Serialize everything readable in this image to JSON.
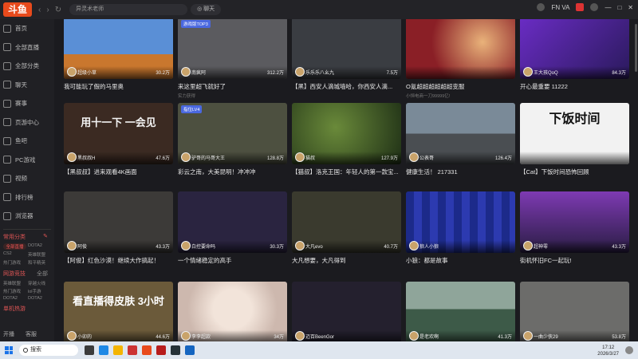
{
  "app": {
    "logo": "斗鱼"
  },
  "topbar": {
    "search_placeholder": "异灵术老师",
    "chat_label": "聊天",
    "right_status": "FN VA"
  },
  "sidebar": {
    "items": [
      {
        "label": "首页",
        "icon": "home-icon"
      },
      {
        "label": "全部直播",
        "icon": "live-icon"
      },
      {
        "label": "全部分类",
        "icon": "category-icon"
      },
      {
        "label": "聊天",
        "icon": "chat-icon"
      },
      {
        "label": "赛事",
        "icon": "trophy-icon"
      },
      {
        "label": "页游中心",
        "icon": "game-icon"
      },
      {
        "label": "鱼吧",
        "icon": "fish-icon"
      },
      {
        "label": "PC游戏",
        "icon": "pc-icon"
      },
      {
        "label": "视频",
        "icon": "video-icon"
      },
      {
        "label": "排行榜",
        "icon": "rank-icon"
      },
      {
        "label": "浏览器",
        "icon": "browser-icon"
      }
    ],
    "common_title": "常用分类",
    "common_tags": [
      "全部直播",
      "DOTA2",
      "CS2",
      "英雄联盟",
      "热门游戏",
      "和平精英"
    ],
    "web_title": "网游竞技",
    "web_more": "全部",
    "web_tags": [
      "英雄联盟",
      "穿越火线",
      "热门游戏",
      "lol手游",
      "DOTA2",
      "DOTA2"
    ],
    "single_title": "单机热游",
    "bottom": [
      "开播",
      "客服"
    ]
  },
  "cards": [
    {
      "title": "我可能玩了假的马里奥",
      "streamer": "超级小草",
      "hot": "30.2万",
      "tag": "",
      "sub": "",
      "color": "#5a8fd6",
      "art": "mario"
    },
    {
      "title": "来这里超飞就好了",
      "streamer": "南疯阿",
      "hot": "312.2万",
      "tag": "游戏版TOP3",
      "sub": "实力获得",
      "color": "#5b5b5f",
      "art": "wheel"
    },
    {
      "title": "【黑】西安人滴城墙哈，你西安人滴...",
      "streamer": "乐乐乐八幺九",
      "hot": "7.5万",
      "tag": "",
      "sub": "",
      "color": "#3a3d42",
      "art": "dark"
    },
    {
      "title": "O氪超超超超超超变服",
      "streamer": "",
      "hot": "",
      "tag": "",
      "sub": "小恒电商一刀99999亿!",
      "color": "#8a1f26",
      "art": "promo"
    },
    {
      "title": "开心最重要 11222",
      "streamer": "王大孩QoQ",
      "hot": "84.3万",
      "tag": "",
      "sub": "",
      "color": "#6a2cc4",
      "art": "girl"
    },
    {
      "title": "【黑叔叔】进来观看4K画面",
      "streamer": "黑叔叔H",
      "hot": "47.6万",
      "tag": "",
      "sub": "",
      "color": "#3b2a22",
      "art": "calligraphy",
      "big": "用十一下 一会见"
    },
    {
      "title": "彩云之南，大美昆明！冲冲冲",
      "streamer": "驴哥的马哥大王",
      "hot": "128.8万",
      "tag": "指位LV4",
      "sub": "",
      "color": "#4d5040",
      "art": "outdoor"
    },
    {
      "title": "【猫叔】洛克王国：年轻人的第一款宝...",
      "streamer": "猫叔",
      "hot": "127.9万",
      "tag": "",
      "sub": "",
      "color": "#2f4a22",
      "art": "green"
    },
    {
      "title": "健康生活！ 217331",
      "streamer": "公表哥",
      "hot": "126.4万",
      "tag": "",
      "sub": "",
      "color": "#5b6a78",
      "art": "street"
    },
    {
      "title": "【Cat】下饭时间恐怖回顾",
      "streamer": "",
      "hot": "",
      "tag": "",
      "sub": "",
      "color": "#f2f2f2",
      "art": "cat",
      "big": "下饭时间"
    },
    {
      "title": "【阿俊】红色沙漠！继续大作搞起！",
      "streamer": "阿俊",
      "hot": "43.3万",
      "tag": "",
      "sub": "",
      "color": "#3c3a38",
      "art": "multi"
    },
    {
      "title": "一个情绪稳定的高手",
      "streamer": "白控要命吗",
      "hot": "30.3万",
      "tag": "",
      "sub": "",
      "color": "#2a2440",
      "art": "pixel"
    },
    {
      "title": "大凡想要，大凡得到",
      "streamer": "大凡evo",
      "hot": "40.7万",
      "tag": "",
      "sub": "",
      "color": "#3a3a2e",
      "art": "board"
    },
    {
      "title": "小狼：都是故事",
      "streamer": "狼人小狼",
      "hot": "",
      "tag": "",
      "sub": "",
      "color": "#1c2a8a",
      "art": "blue"
    },
    {
      "title": "街机怀旧FC一起玩!",
      "streamer": "超神零",
      "hot": "43.3万",
      "tag": "",
      "sub": "",
      "color": "#3d2a5a",
      "art": "purple"
    },
    {
      "title": "",
      "streamer": "小卯的",
      "hot": "44.6万",
      "tag": "",
      "sub": "",
      "color": "#6b5a3a",
      "art": "yellow",
      "big": "看直播得皮肤 3小时"
    },
    {
      "title": "",
      "streamer": "李李超款",
      "hot": "34万",
      "tag": "",
      "sub": "",
      "color": "#d9cfc9",
      "art": "portrait"
    },
    {
      "title": "",
      "streamer": "迈百BeenGor",
      "hot": "",
      "tag": "",
      "sub": "",
      "color": "#24202e",
      "art": "login"
    },
    {
      "title": "",
      "streamer": "是老欢啊",
      "hot": "41.3万",
      "tag": "",
      "sub": "",
      "color": "#465a4a",
      "art": "lake"
    },
    {
      "title": "",
      "streamer": "一曲少侠29",
      "hot": "53.8万",
      "tag": "",
      "sub": "",
      "color": "#6c6c6a",
      "art": "fps"
    }
  ],
  "taskbar": {
    "search_label": "搜索",
    "time": "17:12",
    "date": "2026/3/27"
  }
}
